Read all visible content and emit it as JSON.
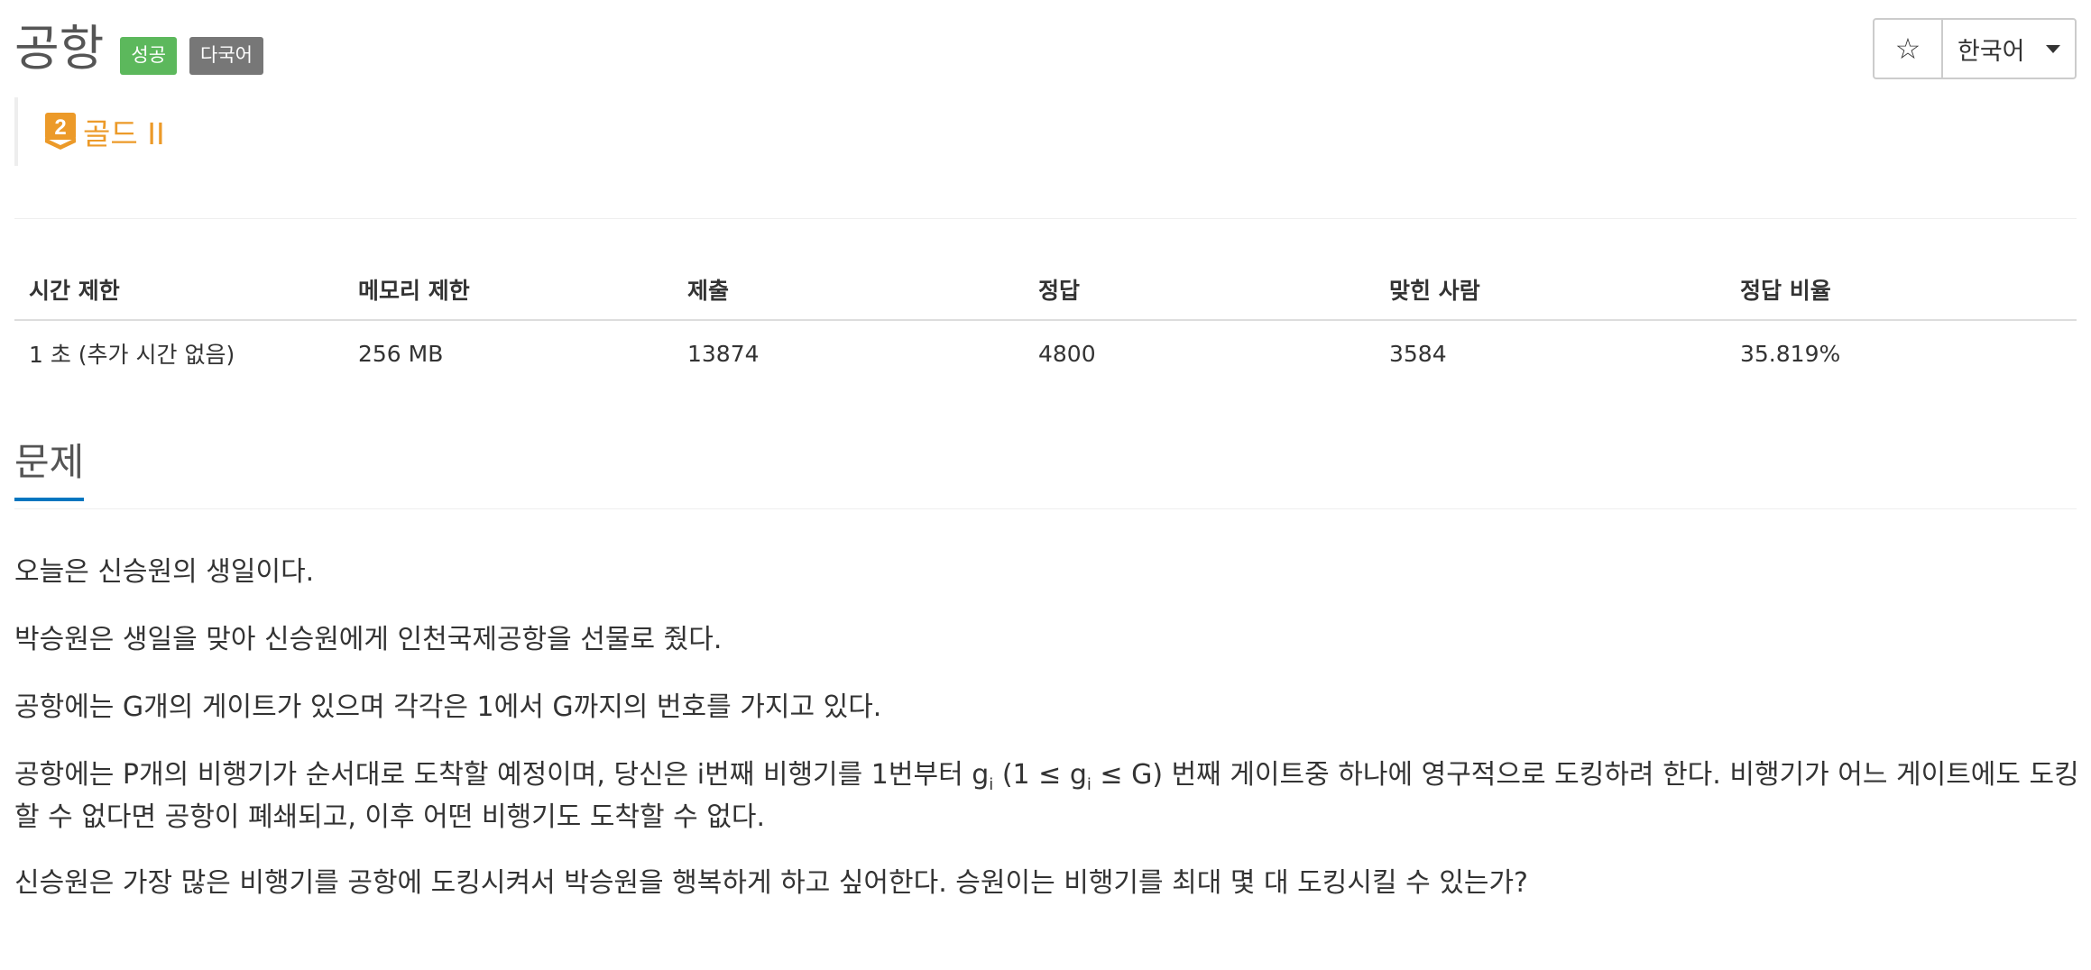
{
  "header": {
    "title": "공항",
    "badges": [
      {
        "label": "성공",
        "color": "#5cb85c"
      },
      {
        "label": "다국어",
        "color": "#777777"
      }
    ],
    "star_icon": "star-icon",
    "language_selected": "한국어"
  },
  "tier": {
    "icon": "gold-tier-2-icon",
    "icon_number": "2",
    "text": "골드 II",
    "color": "#ec9a29"
  },
  "stats": {
    "headers": [
      "시간 제한",
      "메모리 제한",
      "제출",
      "정답",
      "맞힌 사람",
      "정답 비율"
    ],
    "values": [
      "1 초 (추가 시간 없음)",
      "256 MB",
      "13874",
      "4800",
      "3584",
      "35.819%"
    ]
  },
  "section": {
    "title": "문제",
    "accent_color": "#0076c0"
  },
  "problem": {
    "p1": "오늘은 신승원의 생일이다.",
    "p2": "박승원은 생일을 맞아 신승원에게 인천국제공항을 선물로 줬다.",
    "p3": "공항에는 G개의 게이트가 있으며 각각은 1에서 G까지의 번호를 가지고 있다.",
    "p4_a": "공항에는 P개의 비행기가 순서대로 도착할 예정이며, 당신은 i번째 비행기를 1번부터 g",
    "p4_sub1": "i",
    "p4_b": " (1 ≤ g",
    "p4_sub2": "i",
    "p4_c": " ≤ G) 번째 게이트중 하나에 영구적으로 도킹하려 한다. 비행기가 어느 게이트에도 도킹할 수 없다면 공항이 폐쇄되고, 이후 어떤 비행기도 도착할 수 없다.",
    "p5": "신승원은 가장 많은 비행기를 공항에 도킹시켜서 박승원을 행복하게 하고 싶어한다. 승원이는 비행기를 최대 몇 대 도킹시킬 수 있는가?"
  }
}
